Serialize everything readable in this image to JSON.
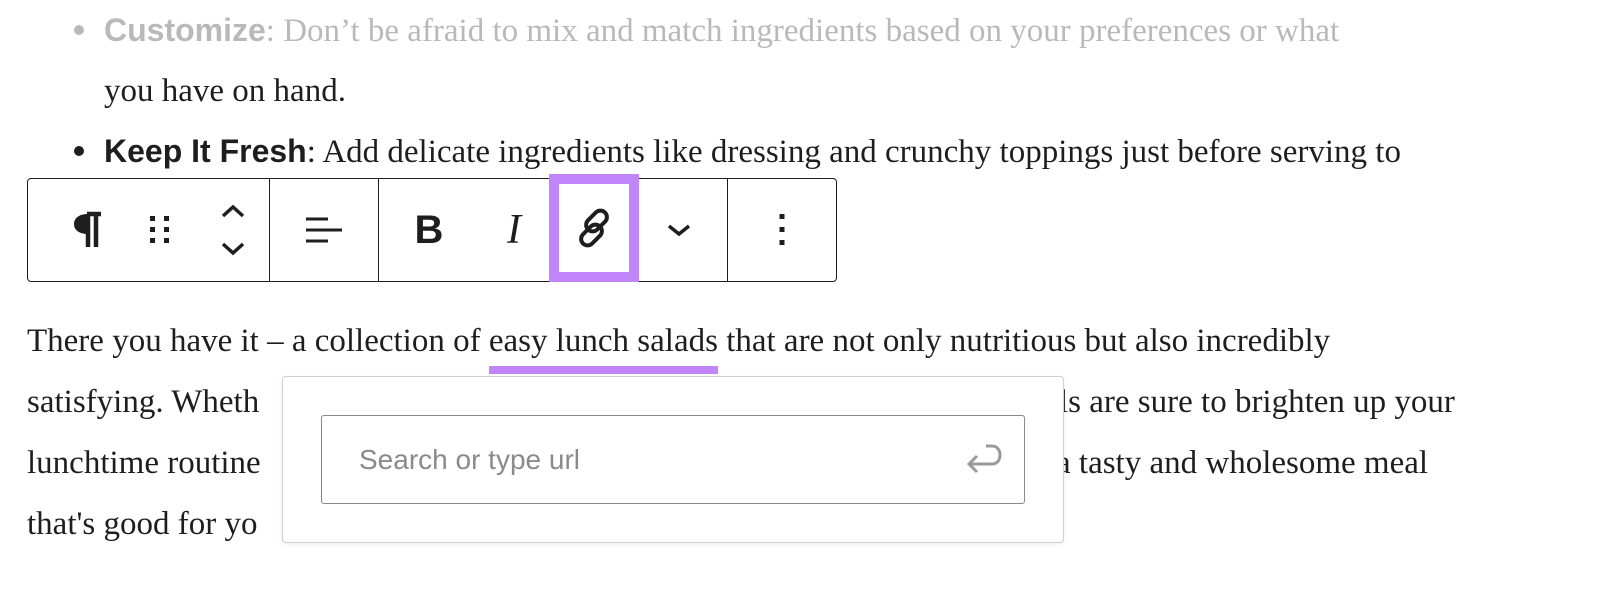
{
  "list_items": [
    {
      "strong": "Customize",
      "rest": ": Don’t be afraid to mix and match ingredients based on your preferences or what",
      "continuation": "you have on hand."
    },
    {
      "strong": "Keep It Fresh",
      "rest": ": Add delicate ingredients like dressing and crunchy toppings just before serving to"
    }
  ],
  "toolbar": {
    "paragraph_icon": "pilcrow-icon",
    "drag_icon": "drag-handle-icon",
    "move_icon": "move-up-down-icon",
    "align_icon": "align-left-icon",
    "bold_label": "B",
    "italic_label": "I",
    "link_icon": "link-icon",
    "more_icon": "chevron-down-icon",
    "options_icon": "more-vertical-icon",
    "highlight_color": "#bf85f9"
  },
  "paragraph": {
    "line1_before": "There you have it – a collection of ",
    "line1_selected": "easy lunch salads",
    "line1_after": " that are not only nutritious but also incredibly",
    "line2_left": "satisfying. Wheth",
    "line2_right": "ls are sure to brighten up your",
    "line3_left": "lunchtime routine",
    "line3_right": "a tasty and wholesome meal",
    "line4_left": "that's good for yo"
  },
  "link_popover": {
    "placeholder": "Search or type url",
    "value": "",
    "submit_icon": "enter-return-icon"
  }
}
